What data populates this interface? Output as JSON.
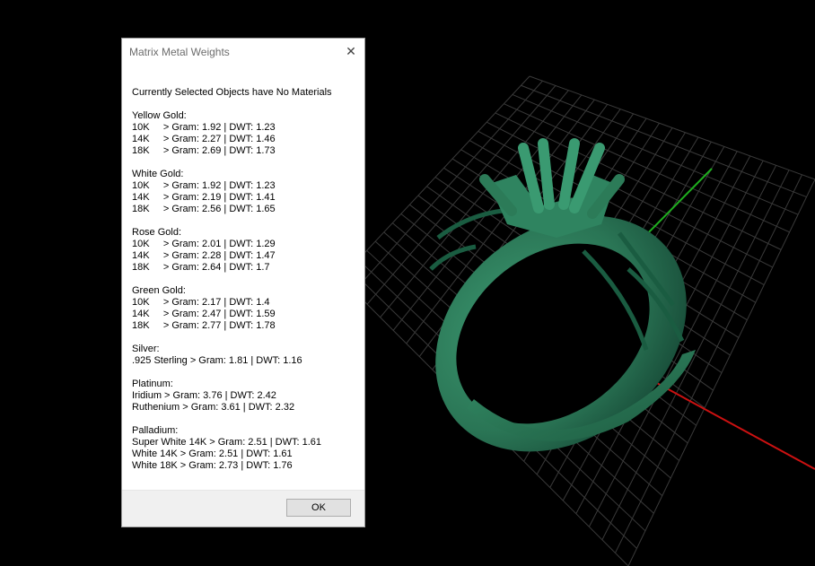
{
  "dialog": {
    "title": "Matrix Metal Weights",
    "close_glyph": "✕",
    "header": "Currently Selected Objects have No Materials",
    "sections": [
      {
        "name": "Yellow Gold:",
        "rows": [
          "10K     > Gram: 1.92 | DWT: 1.23",
          "14K     > Gram: 2.27 | DWT: 1.46",
          "18K     > Gram: 2.69 | DWT: 1.73"
        ]
      },
      {
        "name": "White Gold:",
        "rows": [
          "10K     > Gram: 1.92 | DWT: 1.23",
          "14K     > Gram: 2.19 | DWT: 1.41",
          "18K     > Gram: 2.56 | DWT: 1.65"
        ]
      },
      {
        "name": "Rose Gold:",
        "rows": [
          "10K     > Gram: 2.01 | DWT: 1.29",
          "14K     > Gram: 2.28 | DWT: 1.47",
          "18K     > Gram: 2.64 | DWT: 1.7"
        ]
      },
      {
        "name": "Green Gold:",
        "rows": [
          "10K     > Gram: 2.17 | DWT: 1.4",
          "14K     > Gram: 2.47 | DWT: 1.59",
          "18K     > Gram: 2.77 | DWT: 1.78"
        ]
      },
      {
        "name": "Silver:",
        "rows": [
          ".925 Sterling > Gram: 1.81 | DWT: 1.16"
        ]
      },
      {
        "name": "Platinum:",
        "rows": [
          "Iridium > Gram: 3.76 | DWT: 2.42",
          "Ruthenium > Gram: 3.61 | DWT: 2.32"
        ]
      },
      {
        "name": "Palladium:",
        "rows": [
          "Super White 14K > Gram: 2.51 | DWT: 1.61",
          "White 14K > Gram: 2.51 | DWT: 1.61",
          "White 18K > Gram: 2.73 | DWT: 1.76"
        ]
      }
    ],
    "ok_label": "OK"
  },
  "viewport": {
    "background": "#000000",
    "grid_color": "#3a3a3a",
    "x_axis_color": "#cc1111",
    "y_axis_color": "#1fae1f",
    "ring_color": "#2e7d5b"
  }
}
